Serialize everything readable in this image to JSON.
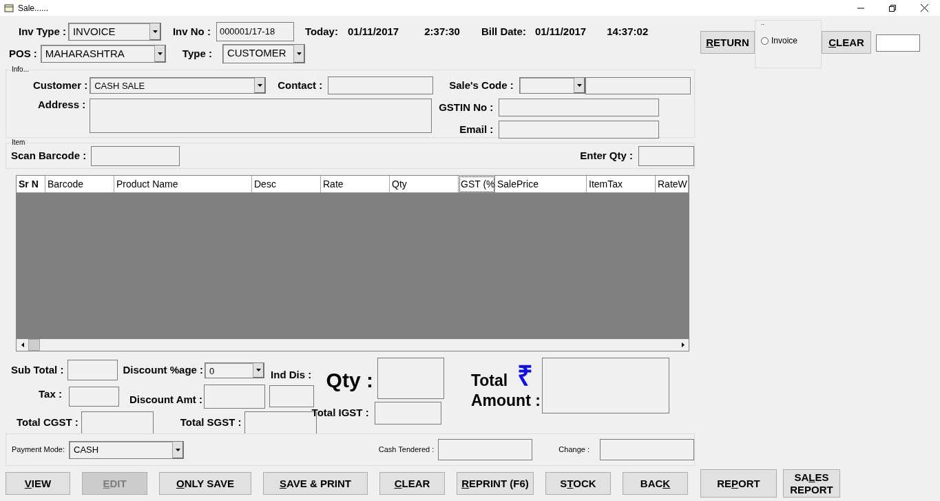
{
  "window": {
    "title": "Sale......"
  },
  "header": {
    "inv_type": {
      "label": "Inv Type :",
      "value": "INVOICE"
    },
    "inv_no": {
      "label": "Inv No :",
      "value": "000001/17-18"
    },
    "today": {
      "label": "Today:",
      "date": "01/11/2017",
      "time": "2:37:30"
    },
    "bill_date": {
      "label": "Bill Date:",
      "date": "01/11/2017",
      "time": "14:37:02"
    },
    "pos": {
      "label": "POS :",
      "value": "MAHARASHTRA"
    },
    "type": {
      "label": "Type :",
      "value": "CUSTOMER"
    }
  },
  "side_top": {
    "return_button": {
      "key": "R",
      "post": "ETURN"
    },
    "group_title": "..",
    "invoice_radio": {
      "label": "Invoice",
      "checked": false
    },
    "clear_button": {
      "key": "C",
      "post": "LEAR"
    }
  },
  "info": {
    "title": "Info...",
    "customer": {
      "label": "Customer :",
      "value": "CASH SALE"
    },
    "contact_label": "Contact :",
    "address_label": "Address :",
    "sales_code_label": "Sale's Code :",
    "gstin_label": "GSTIN No :",
    "email_label": "Email :"
  },
  "item": {
    "title": "Item",
    "scan_label": "Scan Barcode :",
    "qty_label": "Enter Qty :"
  },
  "table": {
    "columns": [
      {
        "label": "Sr N",
        "selected": false
      },
      {
        "label": "Barcode",
        "selected": false
      },
      {
        "label": "Product Name",
        "selected": false
      },
      {
        "label": "Desc",
        "selected": false
      },
      {
        "label": "Rate",
        "selected": false
      },
      {
        "label": "Qty",
        "selected": false
      },
      {
        "label": "GST (%",
        "selected": true
      },
      {
        "label": "SalePrice",
        "selected": false
      },
      {
        "label": "ItemTax",
        "selected": false
      },
      {
        "label": "RateW",
        "selected": false
      }
    ]
  },
  "totals": {
    "sub_total": "Sub Total :",
    "discount_pct": {
      "label": "Discount %age :",
      "value": "0"
    },
    "ind_dis": "Ind Dis :",
    "tax": "Tax :",
    "discount_amt": "Discount Amt :",
    "qty": "Qty :",
    "total": "Total",
    "amount": "Amount :",
    "rupee": "₹",
    "total_cgst": "Total CGST :",
    "total_sgst": "Total SGST :",
    "total_igst": "Total IGST :"
  },
  "payment": {
    "mode": {
      "label": "Payment Mode:",
      "value": "CASH"
    },
    "cash_tendered": "Cash Tendered :",
    "change": "Change :"
  },
  "buttons": [
    {
      "key": "V",
      "post": "IEW",
      "disabled": false
    },
    {
      "key": "E",
      "post": "DIT",
      "disabled": true
    },
    {
      "key": "O",
      "post": "NLY SAVE",
      "disabled": false
    },
    {
      "key": "S",
      "post": "AVE & PRINT",
      "disabled": false
    },
    {
      "key": "C",
      "post": "LEAR",
      "disabled": false
    },
    {
      "key": "R",
      "post": "EPRINT (F6)",
      "disabled": false
    },
    {
      "pre": "S",
      "key": "T",
      "post": "OCK",
      "disabled": false
    },
    {
      "pre": "BAC",
      "key": "K",
      "disabled": false
    }
  ],
  "side_buttons": [
    {
      "pre": "RE",
      "key": "P",
      "post": "ORT"
    },
    {
      "pre": "SA",
      "key": "L",
      "post": "ES REPORT"
    }
  ]
}
